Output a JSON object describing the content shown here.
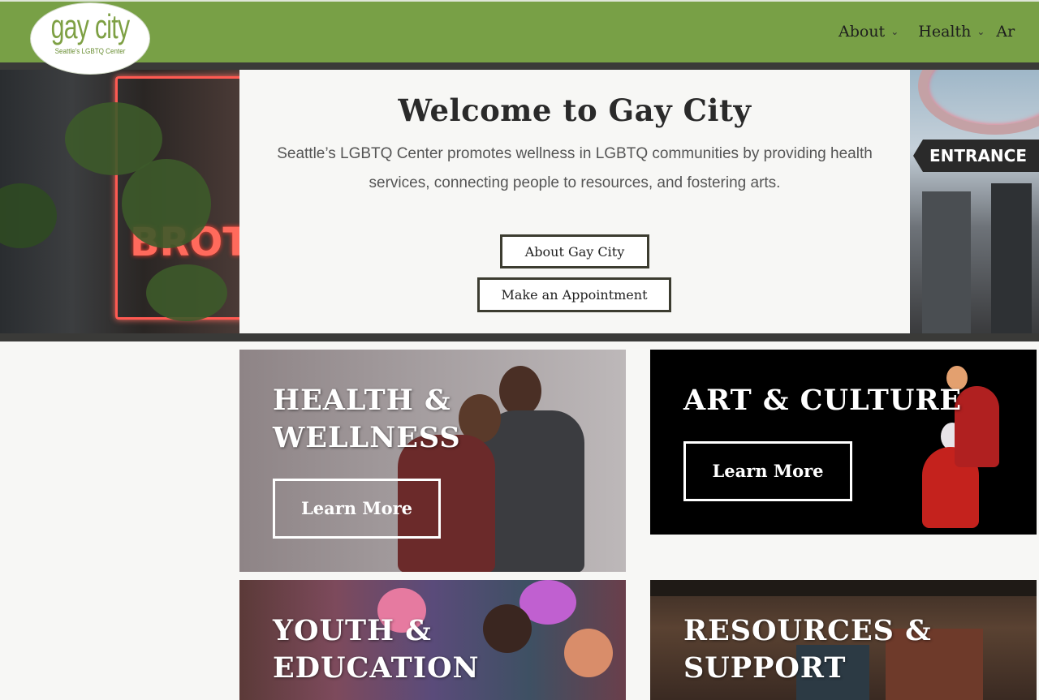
{
  "header": {
    "logo": {
      "name": "gay city",
      "tagline": "Seattle's LGBTQ Center"
    },
    "nav": [
      {
        "label": "About",
        "icon": "chevron-down-icon"
      },
      {
        "label": "Health",
        "icon": "chevron-down-icon"
      },
      {
        "label": "Ar"
      }
    ],
    "colors": {
      "bar": "#78a046",
      "dark_band": "#3a3a38"
    }
  },
  "hero": {
    "title": "Welcome to Gay City",
    "description": "Seattle’s LGBTQ Center promotes wellness in LGBTQ communities by providing health services, connecting people to resources, and fostering arts.",
    "buttons": {
      "about": "About Gay City",
      "appointment": "Make an Appointment"
    },
    "left_photo_neon": "BROTH",
    "right_photo_sign": "ENTRANCE"
  },
  "tiles": [
    {
      "title": "HEALTH &\nWELLNESS",
      "button": "Learn More"
    },
    {
      "title": "ART & CULTURE",
      "button": "Learn More"
    },
    {
      "title": "YOUTH &\nEDUCATION"
    },
    {
      "title": "RESOURCES &\nSUPPORT"
    }
  ]
}
